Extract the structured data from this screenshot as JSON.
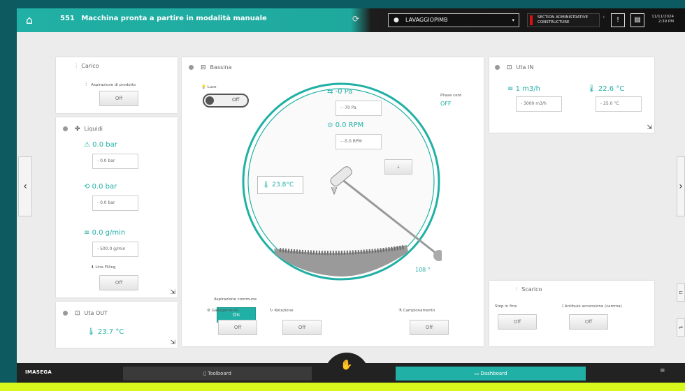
{
  "topbar": {
    "status_code": "551",
    "status_text": "Macchina pronta a partire in modalità manuale",
    "selector_value": "LAVAGGIOPIMB",
    "alert_line1": "SECTION ADMINISTRATIVE",
    "alert_line2": "CONSTRUCTURE",
    "alert_btn": "!",
    "date": "11/11/2024",
    "time": "2:39 PM"
  },
  "carico": {
    "title": "Carico",
    "sub_label": "Aspirazione di prodotto",
    "button": "Off"
  },
  "liquidi": {
    "title": "Liquidi",
    "pressure1_value": "0.0 bar",
    "pressure1_input": "0.0 bar",
    "pressure2_value": "0.0 bar",
    "pressure2_input": "0.0 bar",
    "flow_value": "0.0 g/min",
    "flow_input": "500.0 g/min",
    "filling_label": "Line Filling",
    "filling_button": "Off"
  },
  "uta_out": {
    "title": "Uta OUT",
    "value": "23.7 °C"
  },
  "bassina": {
    "title": "Bassina",
    "luce_label": "Luce",
    "toggle_value": "Off",
    "pa_value": "-0 Pa",
    "pa_input": "-70 Pa",
    "rpm_value": "0.0 RPM",
    "rpm_input": "-5.0 RPM",
    "phase_label": "Phase cent",
    "phase_value": "OFF",
    "temp_value": "23.8°C",
    "angle_value": "108 °",
    "aspirazione_label": "Aspirazione commune",
    "aspirazione_button": "On",
    "gallegamento_label": "Gallegamento",
    "gallegamento_button": "Off",
    "rotazione_label": "Rotazione",
    "rotazione_button": "Off",
    "campionamento_label": "Campionamento",
    "campionamento_button": "Off"
  },
  "uta_in": {
    "title": "Uta IN",
    "flow_value": "1 m3/h",
    "flow_input": "3000 m3/h",
    "temp_value": "22.6 °C",
    "temp_input": "25.0 °C"
  },
  "scarico": {
    "title": "Scarico",
    "stop_label": "Stop in fine",
    "stop_button": "Off",
    "antibuio_label": "Antibuio accensione (camma)",
    "antibuio_button": "Off"
  },
  "bottom": {
    "logo": "IMASEGA",
    "toolboard": "Toolboard",
    "dashboard": "Dashboard"
  },
  "colors": {
    "accent": "#21b0a5",
    "topbar_dark": "#1d1d1d",
    "background": "#0c5b62"
  }
}
